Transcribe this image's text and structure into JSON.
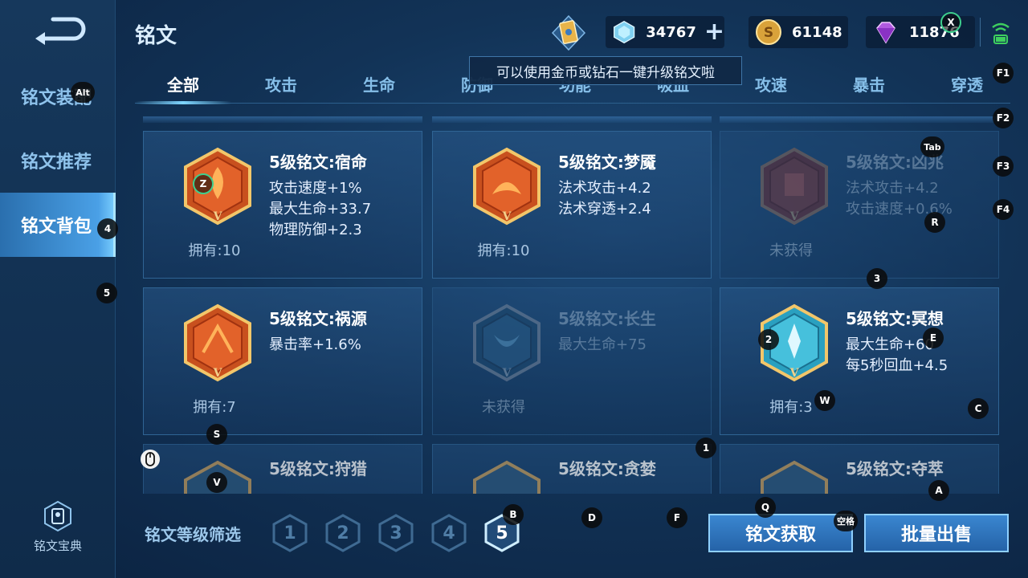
{
  "sidebar": {
    "items": [
      {
        "label": "铭文装配"
      },
      {
        "label": "铭文推荐"
      },
      {
        "label": "铭文背包"
      }
    ],
    "bottom_label": "铭文宝典"
  },
  "header": {
    "title": "铭文",
    "diamond_count": "34767",
    "gold_count": "61148",
    "gem_count": "11876",
    "tooltip": "可以使用金币或钻石一键升级铭文啦"
  },
  "tabs": [
    {
      "label": "全部"
    },
    {
      "label": "攻击"
    },
    {
      "label": "生命"
    },
    {
      "label": "防御"
    },
    {
      "label": "功能"
    },
    {
      "label": "吸血"
    },
    {
      "label": "攻速"
    },
    {
      "label": "暴击"
    },
    {
      "label": "穿透"
    }
  ],
  "cards": [
    {
      "name": "5级铭文:宿命",
      "attrs": [
        "攻击速度+1%",
        "最大生命+33.7",
        "物理防御+2.3"
      ],
      "own": "拥有:10",
      "color": "#d0502a"
    },
    {
      "name": "5级铭文:梦魇",
      "attrs": [
        "法术攻击+4.2",
        "法术穿透+2.4"
      ],
      "own": "拥有:10",
      "color": "#d0502a"
    },
    {
      "name": "5级铭文:凶兆",
      "attrs": [
        "法术攻击+4.2",
        "攻击速度+0.6%"
      ],
      "own": "未获得",
      "color": "#8a3a3a"
    },
    {
      "name": "5级铭文:祸源",
      "attrs": [
        "暴击率+1.6%"
      ],
      "own": "拥有:7",
      "color": "#d0502a"
    },
    {
      "name": "5级铭文:长生",
      "attrs": [
        "最大生命+75"
      ],
      "own": "未获得",
      "color": "#2e6a96"
    },
    {
      "name": "5级铭文:冥想",
      "attrs": [
        "最大生命+60",
        "每5秒回血+4.5"
      ],
      "own": "拥有:3",
      "color": "#3aa6c8"
    },
    {
      "name": "5级铭文:狩猎",
      "attrs": [],
      "own": "",
      "color": "#2e6a96"
    },
    {
      "name": "5级铭文:贪婪",
      "attrs": [],
      "own": "",
      "color": "#2e6a96"
    },
    {
      "name": "5级铭文:夺萃",
      "attrs": [],
      "own": "",
      "color": "#2e6a96"
    }
  ],
  "filter": {
    "label": "铭文等级筛选",
    "levels": [
      "1",
      "2",
      "3",
      "4",
      "5"
    ],
    "selected": "5"
  },
  "buttons": {
    "obtain": "铭文获取",
    "sell": "批量出售"
  },
  "key_hints": [
    "Alt",
    "4",
    "5",
    "Z",
    "2",
    "S",
    "V",
    "X",
    "F1",
    "F2",
    "F3",
    "F4",
    "Tab",
    "R",
    "3",
    "E",
    "W",
    "C",
    "1",
    "A",
    "Q",
    "空格",
    "B",
    "D",
    "F"
  ],
  "colors": {
    "accent": "#4aa0e6",
    "active_tab": "#ffffff",
    "inactive_tab": "#86bfe9"
  }
}
